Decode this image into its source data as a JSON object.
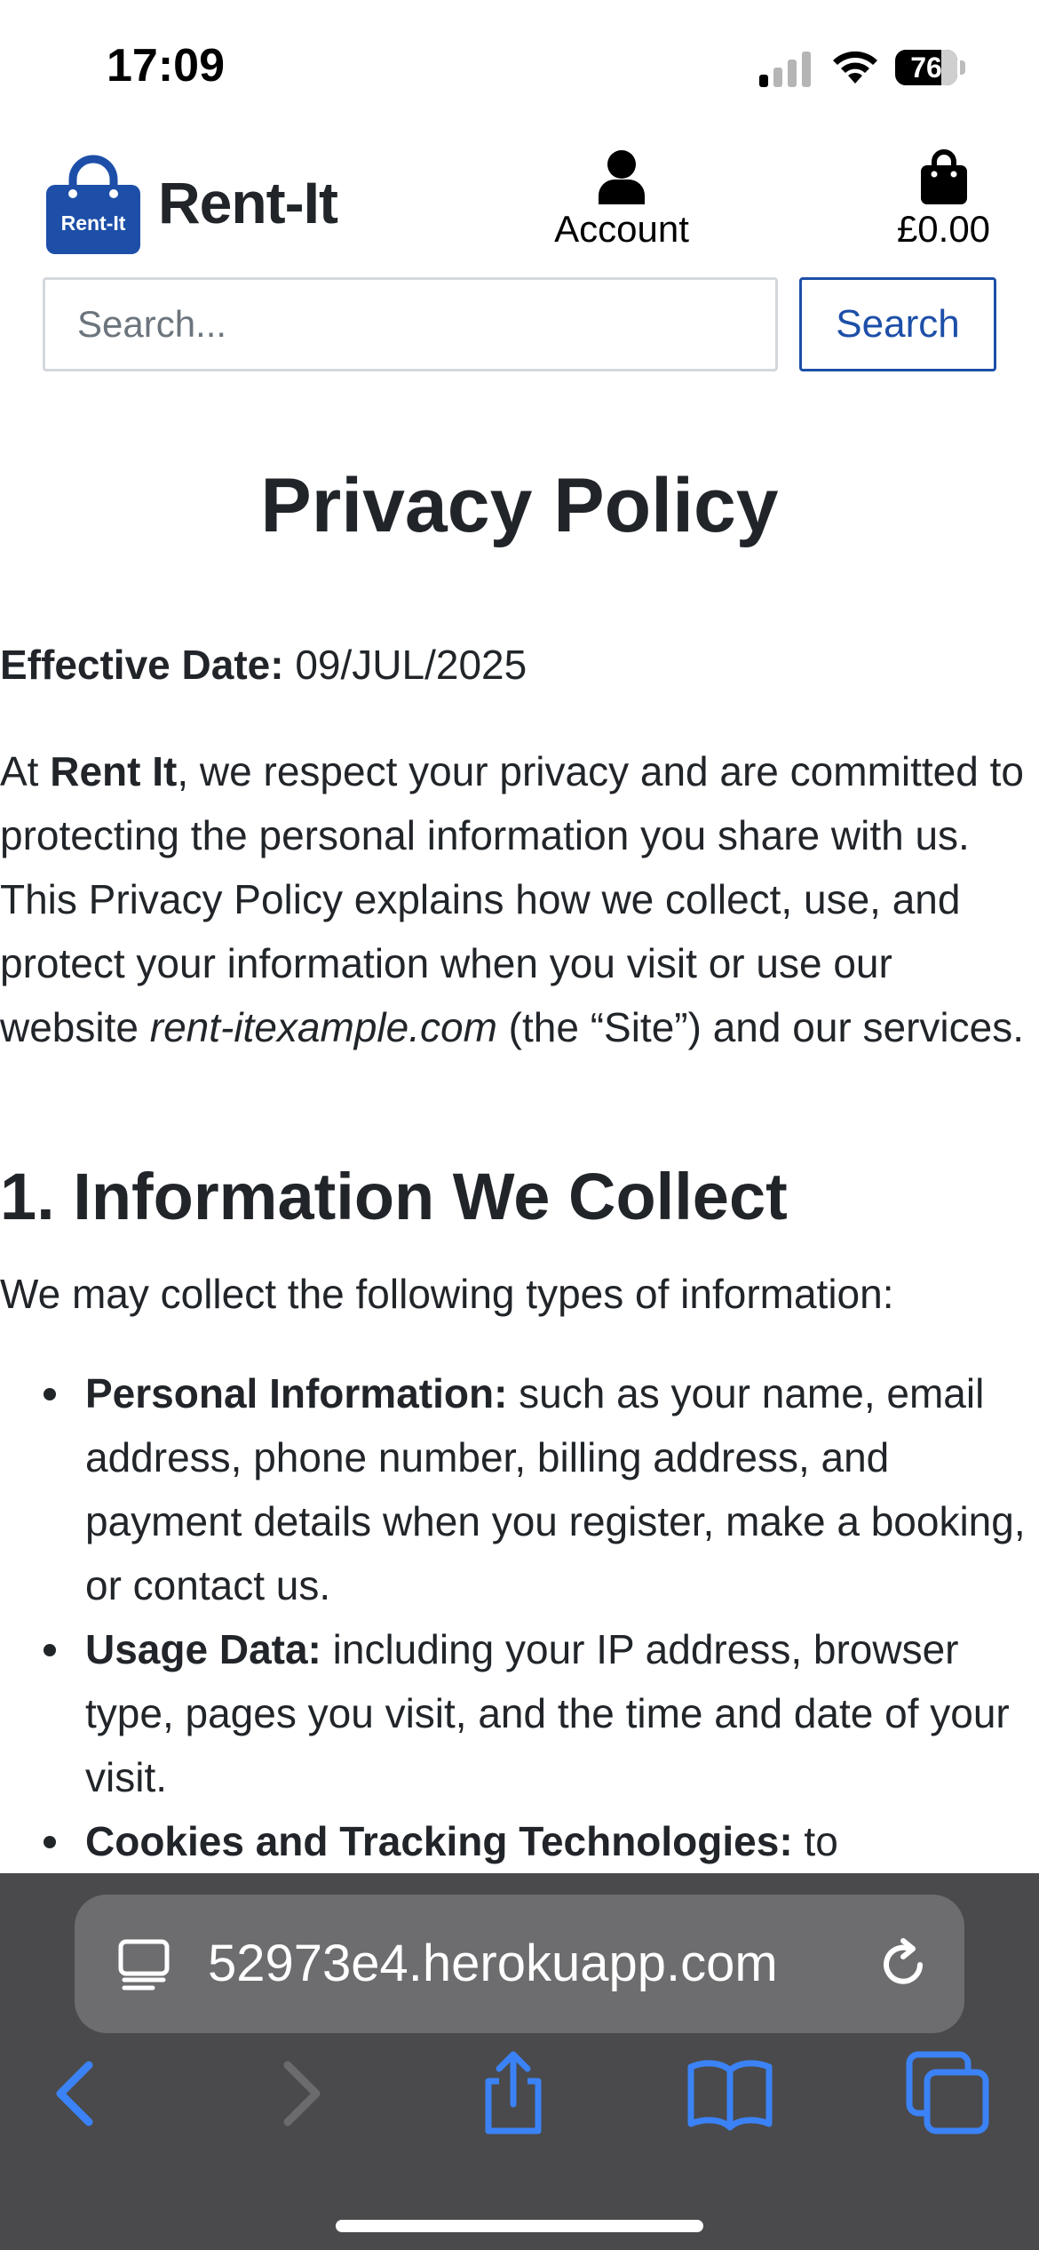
{
  "status_bar": {
    "time": "17:09",
    "battery_level": "76"
  },
  "header": {
    "brand": "Rent-It",
    "logo_text": "Rent-It",
    "account_label": "Account",
    "cart_total": "£0.00"
  },
  "search": {
    "placeholder": "Search...",
    "button_label": "Search"
  },
  "content": {
    "title": "Privacy Policy",
    "effective_label": "Effective Date:",
    "effective_value": " 09/JUL/2025",
    "intro": {
      "prefix": "At ",
      "company": "Rent It",
      "mid": ", we respect your privacy and are committed to protecting the personal information you share with us. This Privacy Policy explains how we collect, use, and protect your information when you visit or use our website ",
      "site": "rent-itexample.com",
      "suffix": " (the “Site”) and our services."
    },
    "section1": {
      "heading": "1. Information We Collect",
      "lead": "We may collect the following types of information:",
      "items": [
        {
          "label": "Personal Information:",
          "text": " such as your name, email address, phone number, billing address, and payment details when you register, make a booking, or contact us."
        },
        {
          "label": "Usage Data:",
          "text": " including your IP address, browser type, pages you visit, and the time and date of your visit."
        },
        {
          "label": "Cookies and Tracking Technologies:",
          "text": " to"
        }
      ]
    }
  },
  "browser": {
    "url": "52973e4.herokuapp.com"
  },
  "colors": {
    "brand_blue": "#1d4fa8",
    "text": "#212529",
    "toolbar_icon": "#3b82f6",
    "browser_bg": "#4a4a4c"
  }
}
